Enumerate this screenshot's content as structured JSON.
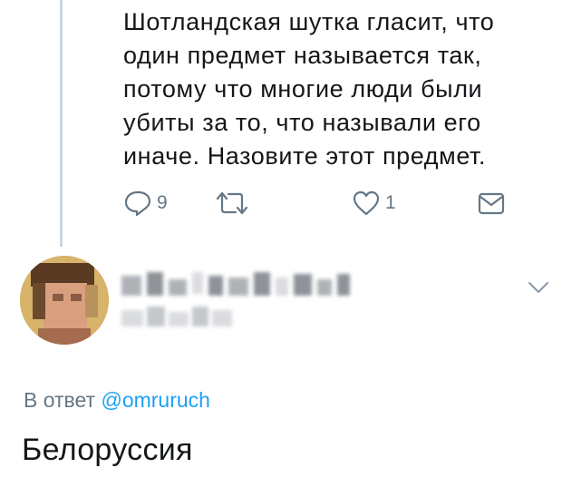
{
  "parent_tweet": {
    "text_lines": [
      "Шотландская шутка гласит, что",
      "один предмет называется так,",
      "потому что многие люди были",
      "убиты за то, что называли его",
      "иначе. Назовите этот предмет."
    ],
    "actions": {
      "reply_count": "9",
      "like_count": "1",
      "icons": [
        "reply-icon",
        "retweet-icon",
        "like-icon",
        "direct-message-icon"
      ]
    }
  },
  "reply_tweet": {
    "replying_to_label": "В ответ",
    "replying_to_handle": "@omruruch",
    "text": "Белоруссия",
    "icons": [
      "avatar",
      "chevron-down-icon"
    ]
  },
  "colors": {
    "text": "#14171a",
    "secondary": "#657786",
    "link": "#1da1f2",
    "thread_line": "#ccd6dd"
  }
}
